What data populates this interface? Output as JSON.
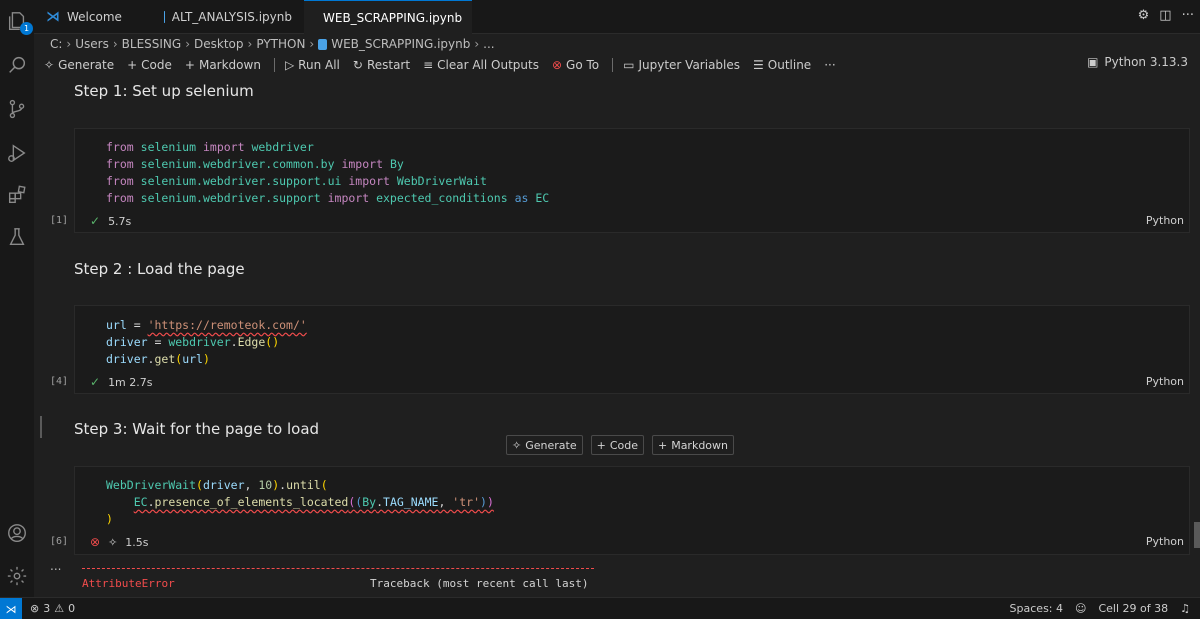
{
  "tabs": [
    {
      "label": "Welcome"
    },
    {
      "label": "ALT_ANALYSIS.ipynb"
    },
    {
      "label": "WEB_SCRAPPING.ipynb"
    }
  ],
  "activity_badge": "1",
  "breadcrumb": [
    "C:",
    "Users",
    "BLESSING",
    "Desktop",
    "PYTHON",
    "WEB_SCRAPPING.ipynb",
    "..."
  ],
  "toolbar": {
    "generate": "Generate",
    "code": "Code",
    "markdown": "Markdown",
    "run_all": "Run All",
    "restart": "Restart",
    "clear_all": "Clear All Outputs",
    "go_to": "Go To",
    "jupyter_vars": "Jupyter Variables",
    "outline": "Outline",
    "more": "···",
    "kernel": "Python 3.13.3"
  },
  "cells": [
    {
      "markdown": "Step 1: Set up selenium",
      "exec_count": "[1]",
      "duration": "5.7s",
      "lang": "Python"
    },
    {
      "markdown": "Step 2 : Load the page",
      "exec_count": "[4]",
      "duration": "1m 2.7s",
      "lang": "Python"
    },
    {
      "markdown": "Step 3: Wait for the page to load",
      "exec_count": "[6]",
      "duration": "1.5s",
      "lang": "Python"
    }
  ],
  "cell_actions": {
    "generate": "Generate",
    "code": "Code",
    "markdown": "Markdown"
  },
  "output": {
    "more": "...",
    "error_name": "AttributeError",
    "traceback": "Traceback (most recent call last)"
  },
  "statusbar": {
    "errors": "3",
    "warnings": "0",
    "spaces": "Spaces: 4",
    "cell_pos": "Cell 29 of 38"
  },
  "colors": {
    "accent": "#0078d4",
    "success": "#59b36b",
    "error": "#f14c4c"
  }
}
